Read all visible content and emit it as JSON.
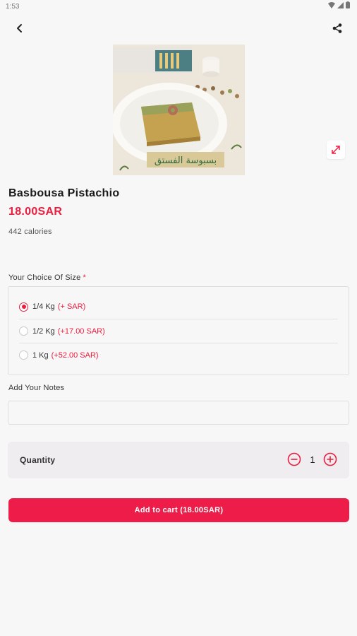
{
  "status_bar": {
    "time": "1:53"
  },
  "appbar": {
    "back_icon": "chevron-left-icon",
    "share_icon": "share-icon"
  },
  "product": {
    "image_caption": "بسبوسة الفستق",
    "name": "Basbousa Pistachio",
    "price": "18.00SAR",
    "calories": "442 calories"
  },
  "size_group": {
    "label": "Your Choice Of Size",
    "required_mark": "*",
    "options": [
      {
        "name": "1/4 Kg",
        "extra": "(+ SAR)",
        "selected": true
      },
      {
        "name": "1/2 Kg",
        "extra": "(+17.00 SAR)",
        "selected": false
      },
      {
        "name": "1 Kg",
        "extra": "(+52.00 SAR)",
        "selected": false
      }
    ]
  },
  "notes": {
    "label": "Add Your Notes",
    "value": "",
    "placeholder": ""
  },
  "quantity": {
    "label": "Quantity",
    "value": "1"
  },
  "add_to_cart": {
    "label": "Add to cart (18.00SAR)"
  },
  "colors": {
    "accent": "#ee1c3e",
    "button": "#ee1c48"
  }
}
